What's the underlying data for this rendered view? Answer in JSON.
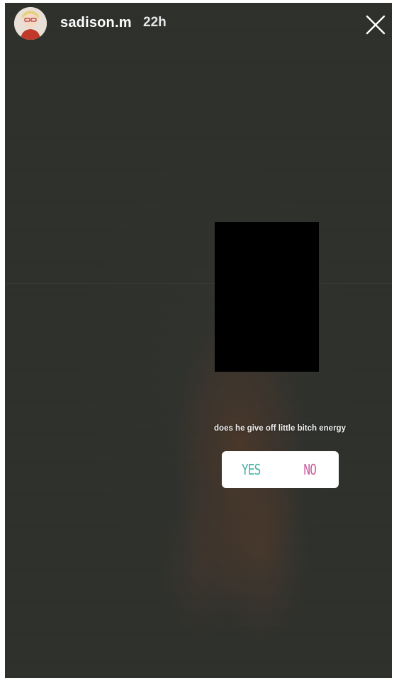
{
  "story": {
    "username": "sadison.m",
    "time_ago": "22h",
    "close_icon": "close-icon",
    "avatar_icon": "avatar-icon"
  },
  "poll": {
    "question": "does he give off little bitch energy",
    "options": [
      "YES",
      "NO"
    ],
    "option_colors": [
      "#46b3a6",
      "#c85d9c"
    ]
  },
  "colors": {
    "background": "#2e302c",
    "redaction": "#000000"
  }
}
